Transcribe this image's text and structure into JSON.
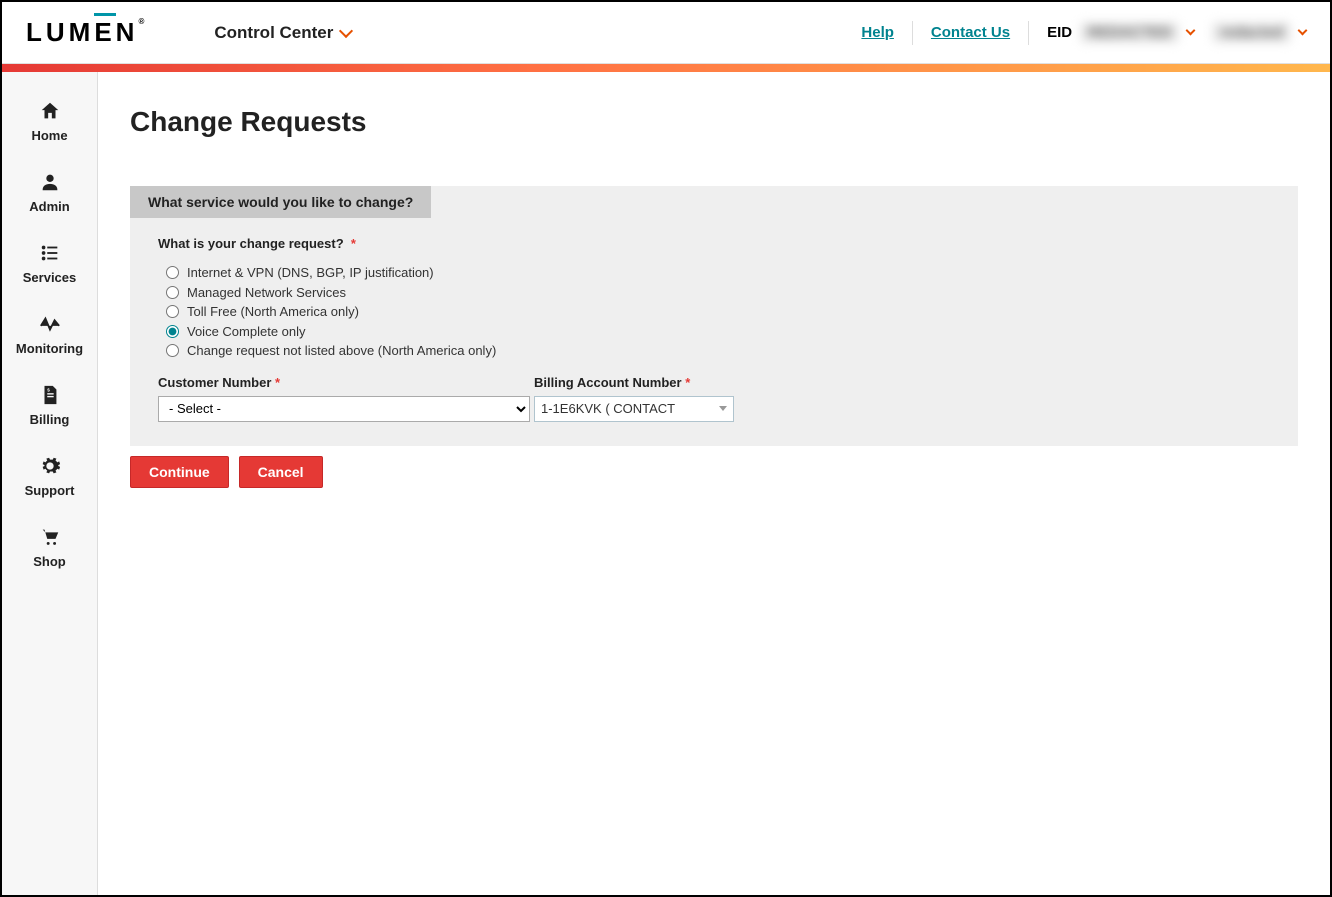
{
  "header": {
    "logo_text": "LUMEN",
    "app_name": "Control Center",
    "help_label": "Help",
    "contact_label": "Contact Us",
    "eid_label": "EID",
    "eid_value": "REDACTED",
    "user_name": "redacted"
  },
  "sidebar": {
    "items": [
      {
        "label": "Home"
      },
      {
        "label": "Admin"
      },
      {
        "label": "Services"
      },
      {
        "label": "Monitoring"
      },
      {
        "label": "Billing"
      },
      {
        "label": "Support"
      },
      {
        "label": "Shop"
      }
    ]
  },
  "page": {
    "title": "Change Requests"
  },
  "form": {
    "panel_title": "What service would you like to change?",
    "question_label": "What is your change request?",
    "options": [
      {
        "label": "Internet & VPN (DNS, BGP, IP justification)",
        "selected": false
      },
      {
        "label": "Managed Network Services",
        "selected": false
      },
      {
        "label": "Toll Free (North America only)",
        "selected": false
      },
      {
        "label": "Voice Complete only",
        "selected": true
      },
      {
        "label": "Change request not listed above (North America only)",
        "selected": false
      }
    ],
    "customer_number_label": "Customer Number",
    "customer_number_value": "- Select -",
    "billing_account_label": "Billing Account Number",
    "billing_account_value": "1-1E6KVK ( CONTACT",
    "continue_label": "Continue",
    "cancel_label": "Cancel"
  }
}
